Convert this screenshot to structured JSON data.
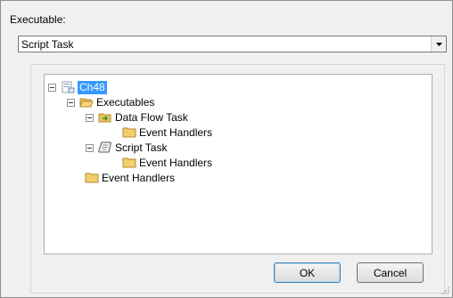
{
  "dialog": {
    "executable_label": "Executable:",
    "selected_executable": "Script Task"
  },
  "tree": {
    "root": "Ch48",
    "executables": "Executables",
    "data_flow_task": "Data Flow Task",
    "data_flow_event_handlers": "Event Handlers",
    "script_task": "Script Task",
    "script_task_event_handlers": "Event Handlers",
    "root_event_handlers": "Event Handlers"
  },
  "buttons": {
    "ok": "OK",
    "cancel": "Cancel"
  },
  "icons": {
    "package": "package-icon",
    "folder": "folder-icon",
    "data_flow": "data-flow-task-icon",
    "script": "script-task-icon"
  }
}
